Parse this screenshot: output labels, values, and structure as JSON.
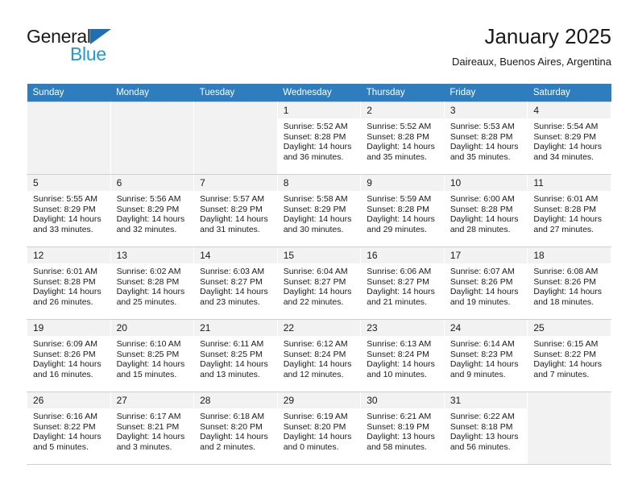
{
  "brand": {
    "name_part1": "General",
    "name_part2": "Blue",
    "accent_color": "#2196e3",
    "triangle_color": "#1f6fb5"
  },
  "header": {
    "title": "January 2025",
    "subtitle": "Daireaux, Buenos Aires, Argentina"
  },
  "calendar": {
    "header_bg": "#2d7dbf",
    "daynum_bg": "#f2f2f2",
    "weekday_headers": [
      "Sunday",
      "Monday",
      "Tuesday",
      "Wednesday",
      "Thursday",
      "Friday",
      "Saturday"
    ],
    "weeks": [
      [
        {
          "empty": true
        },
        {
          "empty": true
        },
        {
          "empty": true
        },
        {
          "day": "1",
          "sunrise": "Sunrise: 5:52 AM",
          "sunset": "Sunset: 8:28 PM",
          "daylight": "Daylight: 14 hours and 36 minutes."
        },
        {
          "day": "2",
          "sunrise": "Sunrise: 5:52 AM",
          "sunset": "Sunset: 8:28 PM",
          "daylight": "Daylight: 14 hours and 35 minutes."
        },
        {
          "day": "3",
          "sunrise": "Sunrise: 5:53 AM",
          "sunset": "Sunset: 8:28 PM",
          "daylight": "Daylight: 14 hours and 35 minutes."
        },
        {
          "day": "4",
          "sunrise": "Sunrise: 5:54 AM",
          "sunset": "Sunset: 8:29 PM",
          "daylight": "Daylight: 14 hours and 34 minutes."
        }
      ],
      [
        {
          "day": "5",
          "sunrise": "Sunrise: 5:55 AM",
          "sunset": "Sunset: 8:29 PM",
          "daylight": "Daylight: 14 hours and 33 minutes."
        },
        {
          "day": "6",
          "sunrise": "Sunrise: 5:56 AM",
          "sunset": "Sunset: 8:29 PM",
          "daylight": "Daylight: 14 hours and 32 minutes."
        },
        {
          "day": "7",
          "sunrise": "Sunrise: 5:57 AM",
          "sunset": "Sunset: 8:29 PM",
          "daylight": "Daylight: 14 hours and 31 minutes."
        },
        {
          "day": "8",
          "sunrise": "Sunrise: 5:58 AM",
          "sunset": "Sunset: 8:29 PM",
          "daylight": "Daylight: 14 hours and 30 minutes."
        },
        {
          "day": "9",
          "sunrise": "Sunrise: 5:59 AM",
          "sunset": "Sunset: 8:28 PM",
          "daylight": "Daylight: 14 hours and 29 minutes."
        },
        {
          "day": "10",
          "sunrise": "Sunrise: 6:00 AM",
          "sunset": "Sunset: 8:28 PM",
          "daylight": "Daylight: 14 hours and 28 minutes."
        },
        {
          "day": "11",
          "sunrise": "Sunrise: 6:01 AM",
          "sunset": "Sunset: 8:28 PM",
          "daylight": "Daylight: 14 hours and 27 minutes."
        }
      ],
      [
        {
          "day": "12",
          "sunrise": "Sunrise: 6:01 AM",
          "sunset": "Sunset: 8:28 PM",
          "daylight": "Daylight: 14 hours and 26 minutes."
        },
        {
          "day": "13",
          "sunrise": "Sunrise: 6:02 AM",
          "sunset": "Sunset: 8:28 PM",
          "daylight": "Daylight: 14 hours and 25 minutes."
        },
        {
          "day": "14",
          "sunrise": "Sunrise: 6:03 AM",
          "sunset": "Sunset: 8:27 PM",
          "daylight": "Daylight: 14 hours and 23 minutes."
        },
        {
          "day": "15",
          "sunrise": "Sunrise: 6:04 AM",
          "sunset": "Sunset: 8:27 PM",
          "daylight": "Daylight: 14 hours and 22 minutes."
        },
        {
          "day": "16",
          "sunrise": "Sunrise: 6:06 AM",
          "sunset": "Sunset: 8:27 PM",
          "daylight": "Daylight: 14 hours and 21 minutes."
        },
        {
          "day": "17",
          "sunrise": "Sunrise: 6:07 AM",
          "sunset": "Sunset: 8:26 PM",
          "daylight": "Daylight: 14 hours and 19 minutes."
        },
        {
          "day": "18",
          "sunrise": "Sunrise: 6:08 AM",
          "sunset": "Sunset: 8:26 PM",
          "daylight": "Daylight: 14 hours and 18 minutes."
        }
      ],
      [
        {
          "day": "19",
          "sunrise": "Sunrise: 6:09 AM",
          "sunset": "Sunset: 8:26 PM",
          "daylight": "Daylight: 14 hours and 16 minutes."
        },
        {
          "day": "20",
          "sunrise": "Sunrise: 6:10 AM",
          "sunset": "Sunset: 8:25 PM",
          "daylight": "Daylight: 14 hours and 15 minutes."
        },
        {
          "day": "21",
          "sunrise": "Sunrise: 6:11 AM",
          "sunset": "Sunset: 8:25 PM",
          "daylight": "Daylight: 14 hours and 13 minutes."
        },
        {
          "day": "22",
          "sunrise": "Sunrise: 6:12 AM",
          "sunset": "Sunset: 8:24 PM",
          "daylight": "Daylight: 14 hours and 12 minutes."
        },
        {
          "day": "23",
          "sunrise": "Sunrise: 6:13 AM",
          "sunset": "Sunset: 8:24 PM",
          "daylight": "Daylight: 14 hours and 10 minutes."
        },
        {
          "day": "24",
          "sunrise": "Sunrise: 6:14 AM",
          "sunset": "Sunset: 8:23 PM",
          "daylight": "Daylight: 14 hours and 9 minutes."
        },
        {
          "day": "25",
          "sunrise": "Sunrise: 6:15 AM",
          "sunset": "Sunset: 8:22 PM",
          "daylight": "Daylight: 14 hours and 7 minutes."
        }
      ],
      [
        {
          "day": "26",
          "sunrise": "Sunrise: 6:16 AM",
          "sunset": "Sunset: 8:22 PM",
          "daylight": "Daylight: 14 hours and 5 minutes."
        },
        {
          "day": "27",
          "sunrise": "Sunrise: 6:17 AM",
          "sunset": "Sunset: 8:21 PM",
          "daylight": "Daylight: 14 hours and 3 minutes."
        },
        {
          "day": "28",
          "sunrise": "Sunrise: 6:18 AM",
          "sunset": "Sunset: 8:20 PM",
          "daylight": "Daylight: 14 hours and 2 minutes."
        },
        {
          "day": "29",
          "sunrise": "Sunrise: 6:19 AM",
          "sunset": "Sunset: 8:20 PM",
          "daylight": "Daylight: 14 hours and 0 minutes."
        },
        {
          "day": "30",
          "sunrise": "Sunrise: 6:21 AM",
          "sunset": "Sunset: 8:19 PM",
          "daylight": "Daylight: 13 hours and 58 minutes."
        },
        {
          "day": "31",
          "sunrise": "Sunrise: 6:22 AM",
          "sunset": "Sunset: 8:18 PM",
          "daylight": "Daylight: 13 hours and 56 minutes."
        },
        {
          "empty": true
        }
      ]
    ]
  }
}
